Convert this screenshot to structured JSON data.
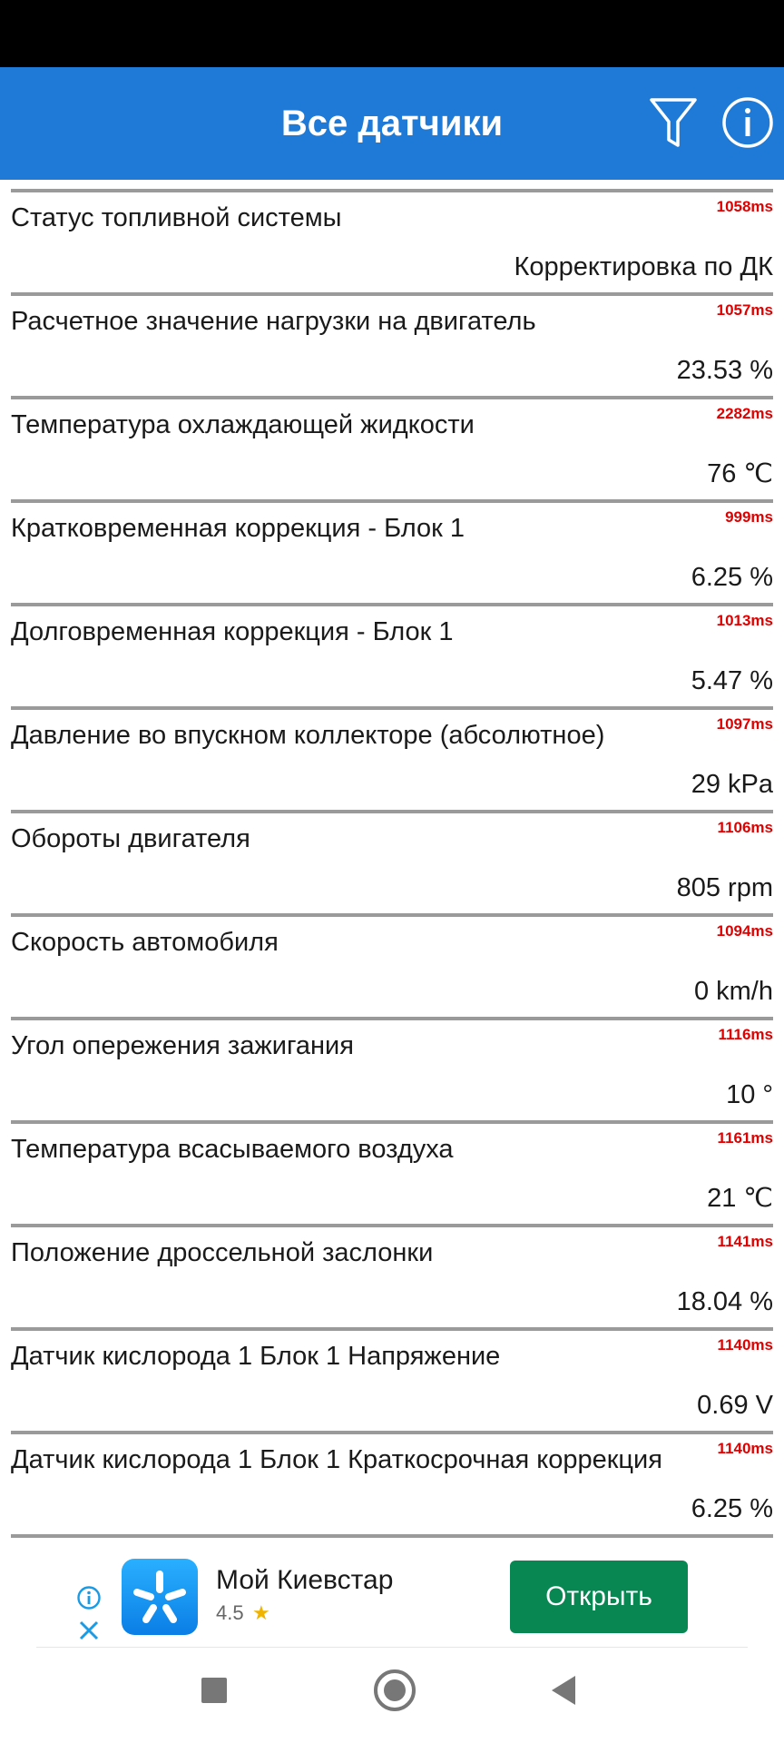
{
  "app": {
    "title": "Все датчики"
  },
  "sensors": [
    {
      "name": "Статус топливной системы",
      "ms": "1058ms",
      "value": "Корректировка по ДК"
    },
    {
      "name": "Расчетное значение нагрузки на двигатель",
      "ms": "1057ms",
      "value": "23.53 %"
    },
    {
      "name": "Температура охлаждающей жидкости",
      "ms": "2282ms",
      "value": "76 ℃"
    },
    {
      "name": "Кратковременная коррекция - Блок 1",
      "ms": "999ms",
      "value": "6.25 %"
    },
    {
      "name": "Долговременная коррекция - Блок 1",
      "ms": "1013ms",
      "value": "5.47 %"
    },
    {
      "name": "Давление во впускном коллекторе (абсолютное)",
      "ms": "1097ms",
      "value": "29 kPa"
    },
    {
      "name": "Обороты двигателя",
      "ms": "1106ms",
      "value": "805 rpm"
    },
    {
      "name": "Скорость автомобиля",
      "ms": "1094ms",
      "value": "0 km/h"
    },
    {
      "name": "Угол опережения зажигания",
      "ms": "1116ms",
      "value": "10 °"
    },
    {
      "name": "Температура всасываемого воздуха",
      "ms": "1161ms",
      "value": "21 ℃"
    },
    {
      "name": "Положение дроссельной заслонки",
      "ms": "1141ms",
      "value": "18.04 %"
    },
    {
      "name": "Датчик кислорода 1 Блок 1 Напряжение",
      "ms": "1140ms",
      "value": "0.69 V"
    },
    {
      "name": "Датчик кислорода 1 Блок 1 Краткосрочная коррекция",
      "ms": "1140ms",
      "value": "6.25 %"
    }
  ],
  "ad": {
    "name": "Мой Киевстар",
    "rating": "4.5",
    "open_label": "Открыть"
  },
  "icons": {
    "filter": "filter-icon",
    "info": "info-icon",
    "ad_info": "ad-info-icon",
    "ad_close": "close-icon",
    "star": "star-icon",
    "nav_recent": "square-icon",
    "nav_home": "circle-icon",
    "nav_back": "back-triangle-icon"
  },
  "colors": {
    "app_bar": "#1e7ad6",
    "ms_text": "#e00000",
    "ad_button": "#088753"
  }
}
